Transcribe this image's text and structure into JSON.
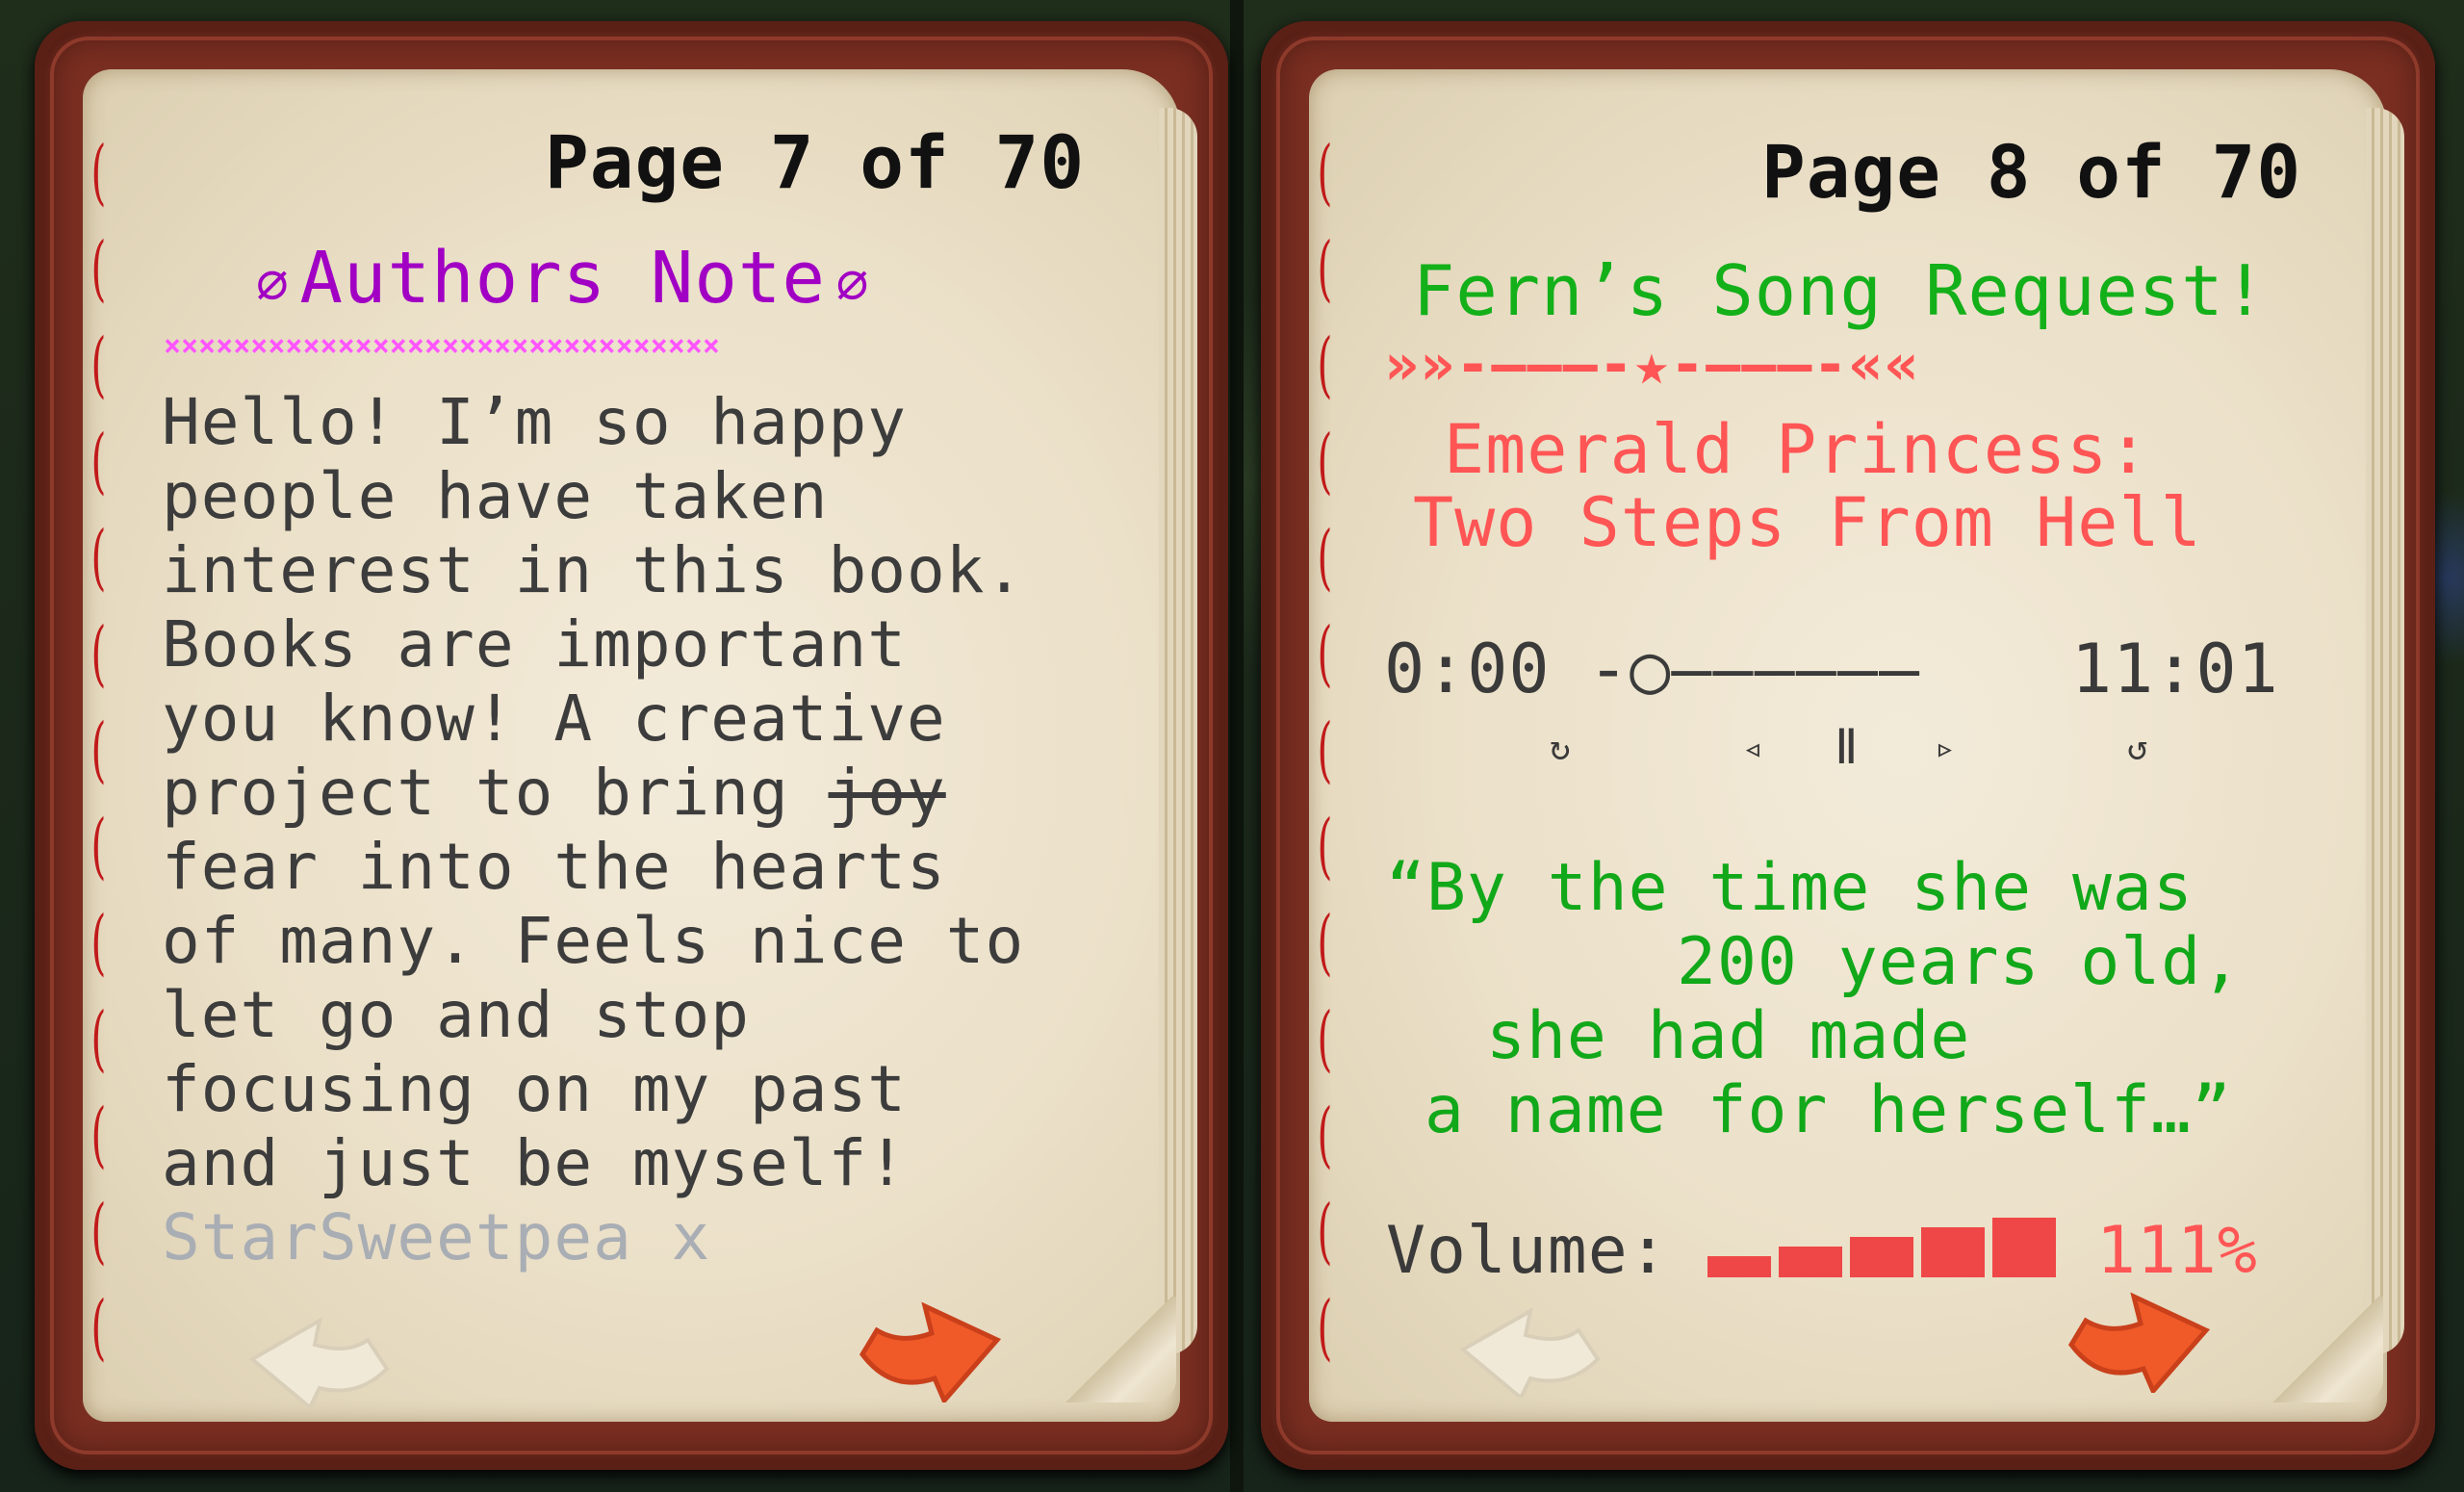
{
  "left": {
    "page_label": "Page 7 of 70",
    "title": "Authors Note",
    "clip_icon": "paperclip-icon",
    "divider_text": "××××××××××××××××××××××××××××××××",
    "body_lines": [
      "Hello! I’m so happy",
      "people have taken",
      "interest in this book.",
      "Books are important",
      "you know! A creative",
      "project to bring",
      "fear into the hearts",
      "of many. Feels nice to",
      "let go and stop",
      "focusing on my past",
      "and just be myself!"
    ],
    "struck_word": "joy",
    "signature": "StarSweetpea x",
    "prev_icon": "back-arrow-icon",
    "next_icon": "forward-arrow-icon"
  },
  "right": {
    "page_label": "Page 8 of 70",
    "title": "Fern’s Song Request!",
    "divider_text": "»»-———-★-———-««",
    "song_line1": "Emerald Princess:",
    "song_line2": "Two Steps From Hell",
    "time_start": "0:00",
    "progress_track": "-○——————",
    "time_end": "11:01",
    "controls": {
      "replay": "↻",
      "prev": "◃",
      "pause": "Ⅱ",
      "next": "▹",
      "repeat": "↺"
    },
    "quote_lines": [
      "“By the time she was",
      "200 years old,",
      "she had made",
      "a name for herself…”"
    ],
    "volume_label": "Volume:",
    "volume_value": "111%",
    "volume_level": 1.11,
    "prev_icon": "back-arrow-icon",
    "next_icon": "forward-arrow-icon"
  },
  "colors": {
    "purple": "#a100c4",
    "pink": "#ff55ff",
    "green": "#13b01a",
    "red": "#ff5555",
    "orange": "#f05a28",
    "leather": "#7b2f22"
  }
}
